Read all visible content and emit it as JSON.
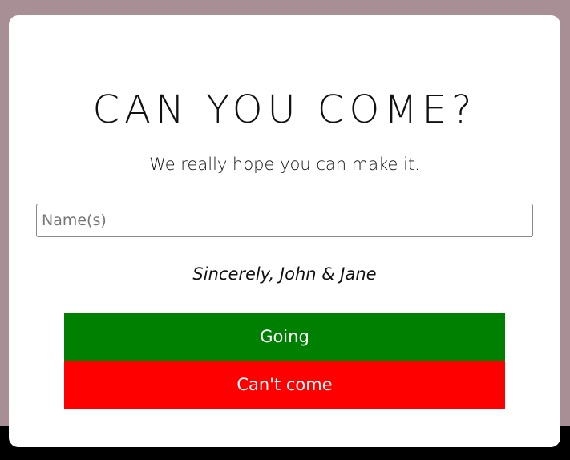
{
  "modal": {
    "title": "CAN YOU COME?",
    "subtitle": "We really hope you can make it.",
    "name_input": {
      "placeholder": "Name(s)",
      "value": ""
    },
    "signature": "Sincerely, John & Jane",
    "buttons": {
      "going_label": "Going",
      "cant_come_label": "Can't come"
    }
  },
  "colors": {
    "backdrop": "#a88e95",
    "modal_background": "#ffffff",
    "going_button": "#008000",
    "cant_come_button": "#ff0000",
    "bottom_bar": "#000000"
  }
}
